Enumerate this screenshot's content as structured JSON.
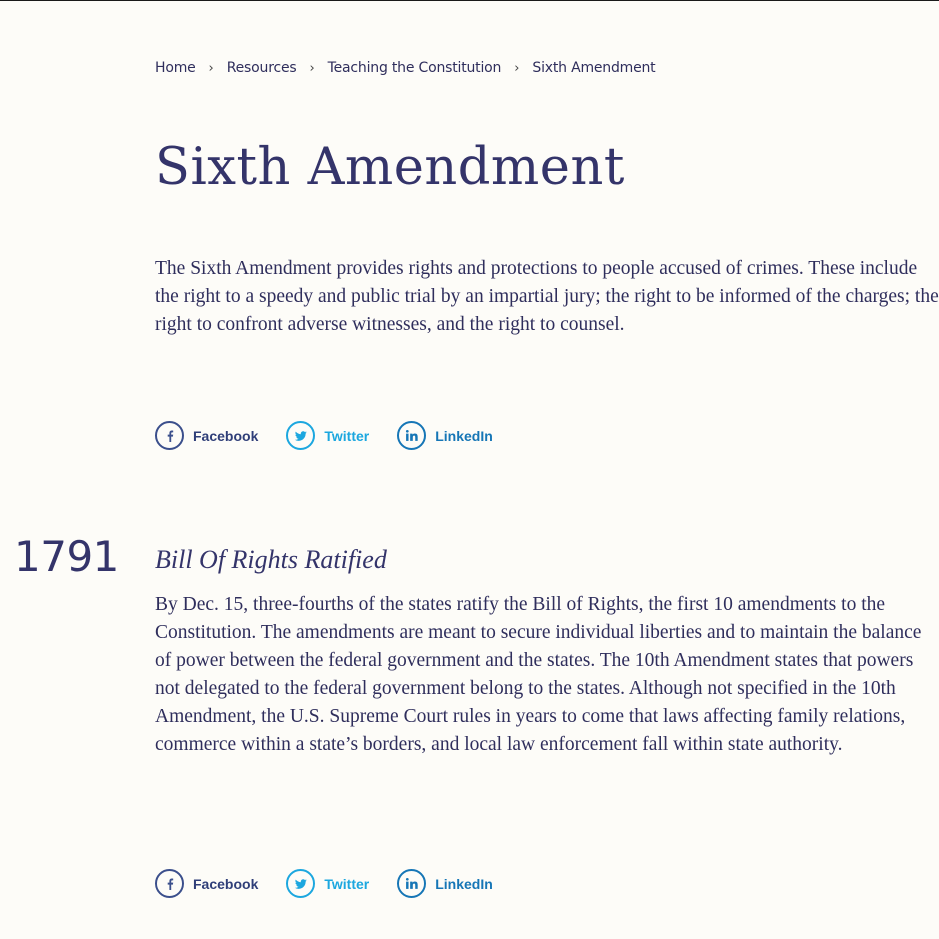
{
  "breadcrumb": {
    "items": [
      "Home",
      "Resources",
      "Teaching the Constitution",
      "Sixth Amendment"
    ],
    "separator": "›"
  },
  "page": {
    "title": "Sixth Amendment",
    "intro": "The Sixth Amendment provides rights and protections to people accused of crimes. These include the right to a speedy and public trial by an impartial jury; the right to be informed of the charges; the right to confront adverse witnesses, and the right to counsel."
  },
  "share": {
    "facebook": "Facebook",
    "twitter": "Twitter",
    "linkedin": "LinkedIn"
  },
  "timeline": {
    "events": [
      {
        "year": "1791",
        "title": "Bill Of Rights Ratified",
        "body": "By Dec. 15, three-fourths of the states ratify the Bill of Rights, the first 10 amendments to the Constitution. The amendments are meant to secure individual liberties and to maintain the balance of power between the federal government and the states. The 10th Amendment states that powers not delegated to the federal government belong to the states. Although not specified in the 10th Amendment, the U.S. Supreme Court rules in years to come that laws affecting family relations, commerce within a state’s borders, and local law enforcement fall within state authority."
      }
    ]
  },
  "colors": {
    "background": "#fdfcf8",
    "text": "#2f2e5c",
    "facebook": "#3b4f8c",
    "twitter": "#1ca7df",
    "linkedin": "#1676b6"
  },
  "icons": {
    "facebook": "facebook-icon",
    "twitter": "twitter-icon",
    "linkedin": "linkedin-icon",
    "separator": "chevron-right-icon"
  }
}
